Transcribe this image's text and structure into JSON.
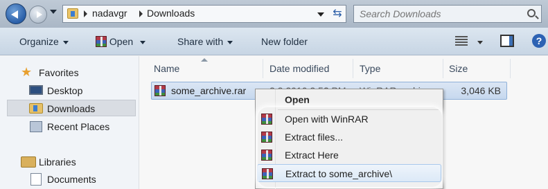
{
  "address": {
    "crumbs": [
      "nadavgr",
      "Downloads"
    ],
    "search_placeholder": "Search Downloads"
  },
  "toolbar": {
    "organize": "Organize",
    "open": "Open",
    "share_with": "Share with",
    "new_folder": "New folder"
  },
  "nav": {
    "favorites": "Favorites",
    "desktop": "Desktop",
    "downloads": "Downloads",
    "recent_places": "Recent Places",
    "libraries": "Libraries",
    "documents": "Documents"
  },
  "columns": {
    "name": "Name",
    "date_modified": "Date modified",
    "type": "Type",
    "size": "Size"
  },
  "file": {
    "name": "some_archive.rar",
    "date_fragment": "2 2 2010 2 5? PM",
    "type_fragment": "WinRAR archive",
    "size": "3,046 KB"
  },
  "context_menu": {
    "items": [
      {
        "label": "Open",
        "bold": true
      },
      {
        "label": "Open with WinRAR"
      },
      {
        "label": "Extract files..."
      },
      {
        "label": "Extract Here"
      },
      {
        "label": "Extract to some_archive\\"
      }
    ]
  },
  "icons": {
    "back": "back-arrow-icon",
    "forward": "forward-arrow-icon",
    "refresh": "refresh-icon",
    "search": "search-icon",
    "winrar": "winrar-archive-icon",
    "help": "help-icon"
  }
}
